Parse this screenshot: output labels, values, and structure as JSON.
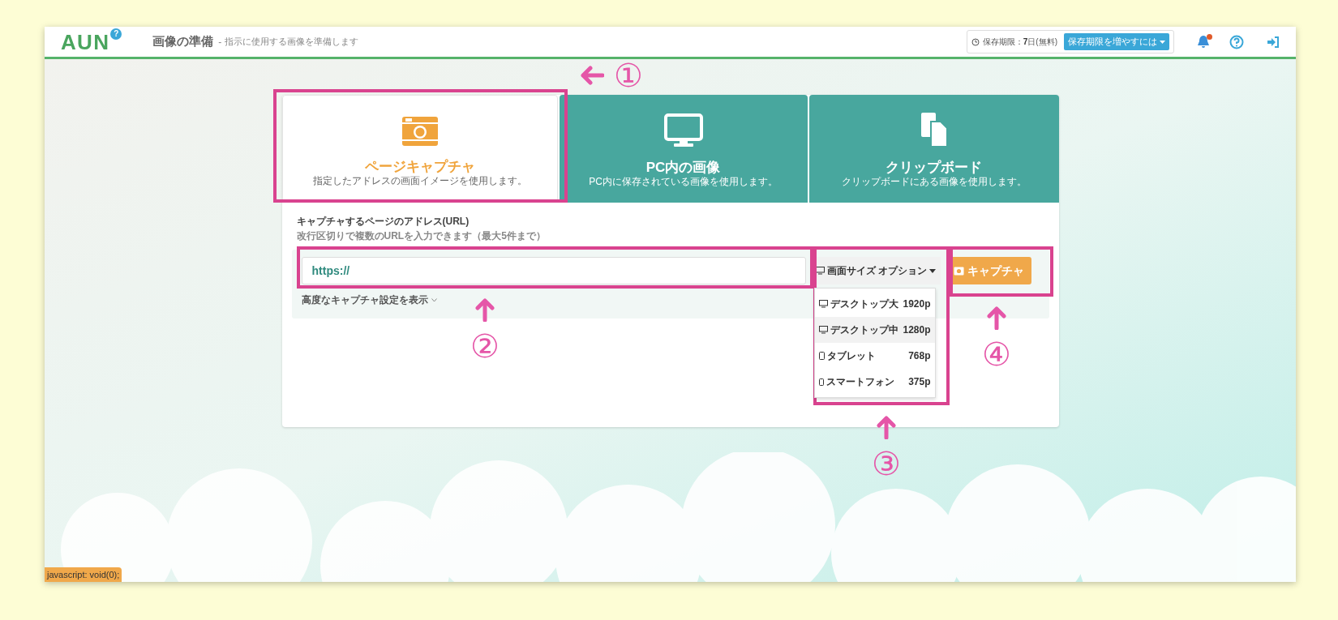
{
  "header": {
    "logo": "AUN",
    "logo_badge": "?",
    "title": "画像の準備",
    "separator": "-",
    "subtitle": "指示に使用する画像を準備します",
    "retention_label": "保存期限：",
    "retention_value": "7",
    "retention_suffix": "日(無料)",
    "extend_button": "保存期限を増やすには",
    "notification_dot": true
  },
  "tabs": [
    {
      "kind": "camera",
      "label": "ページキャプチャ",
      "description": "指定したアドレスの画面イメージを使用します。",
      "selected": true
    },
    {
      "kind": "monitor",
      "label": "PC内の画像",
      "description": "PC内に保存されている画像を使用します。",
      "selected": false
    },
    {
      "kind": "clipboard",
      "label": "クリップボード",
      "description": "クリップボードにある画像を使用します。",
      "selected": false
    }
  ],
  "form": {
    "label": "キャプチャするページのアドレス(URL)",
    "hint": "改行区切りで複数のURLを入力できます（最大5件まで）",
    "url_value": "https://",
    "size_button": "画面サイズ",
    "size_option": "オプション",
    "capture_button": "キャプチャ",
    "advanced_link": "高度なキャプチャ設定を表示"
  },
  "size_menu": [
    {
      "kind": "desktop",
      "label": "デスクトップ大",
      "size": "1920p",
      "selected": false
    },
    {
      "kind": "desktop",
      "label": "デスクトップ中",
      "size": "1280p",
      "selected": true
    },
    {
      "kind": "tablet",
      "label": "タブレット",
      "size": "768p",
      "selected": false
    },
    {
      "kind": "phone",
      "label": "スマートフォン",
      "size": "375p",
      "selected": false
    }
  ],
  "annotations": [
    "①",
    "②",
    "③",
    "④"
  ],
  "status_bar": "javascript: void(0);"
}
